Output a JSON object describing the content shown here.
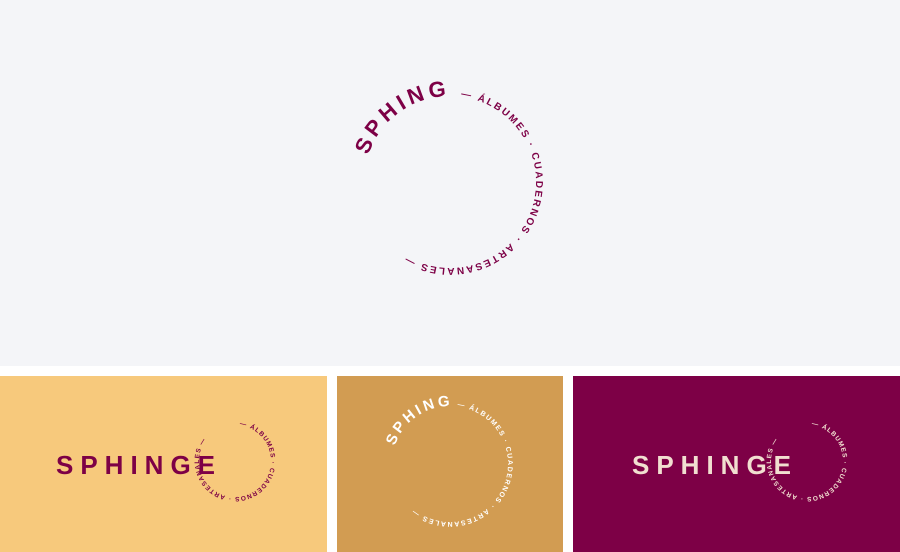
{
  "brand": {
    "name": "SPHINGE",
    "tagline_top": "ÁLBUMES",
    "tagline_mid": "CUADERNOS",
    "tagline_bottom": "ARTESANALES",
    "dot": "·",
    "dash": "—"
  },
  "colors": {
    "background_top": "#f4f5f8",
    "magenta": "#7d0046",
    "yellow": "#f7c97c",
    "ochre": "#d29c52",
    "cream": "#f1dfd0",
    "white": "#ffffff"
  }
}
